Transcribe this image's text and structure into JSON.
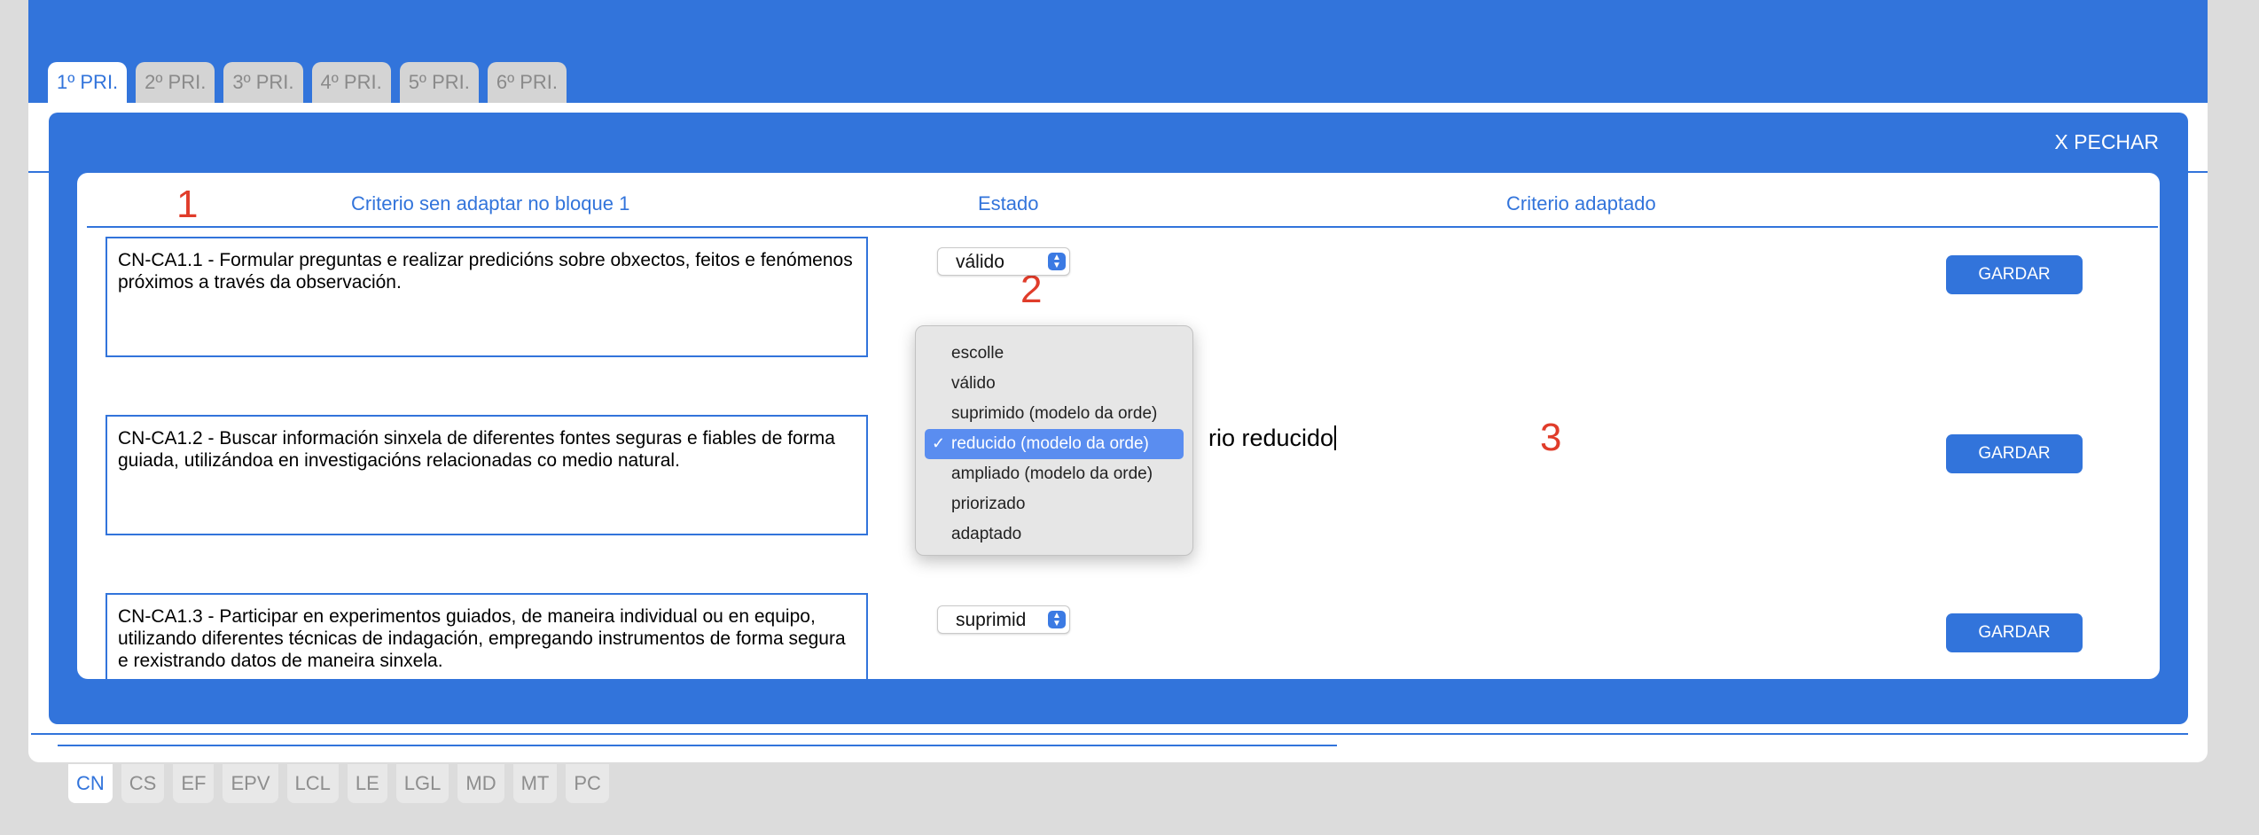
{
  "grade_tabs": [
    {
      "label": "1º PRI.",
      "active": true
    },
    {
      "label": "2º PRI.",
      "active": false
    },
    {
      "label": "3º PRI.",
      "active": false
    },
    {
      "label": "4º PRI.",
      "active": false
    },
    {
      "label": "5º PRI.",
      "active": false
    },
    {
      "label": "6º PRI.",
      "active": false
    }
  ],
  "modal": {
    "close_label": "X PECHAR",
    "headers": {
      "criterion": "Criterio sen adaptar no bloque 1",
      "status": "Estado",
      "adapted": "Criterio adaptado"
    },
    "rows": [
      {
        "criterion": "CN-CA1.1 - Formular preguntas e realizar predicións sobre obxectos, feitos e fenómenos próximos a través da observación.",
        "status": "válido",
        "save_label": "GARDAR"
      },
      {
        "criterion": "CN-CA1.2 - Buscar información sinxela de diferentes fontes seguras e fiables de forma guiada, utilizándoa en investigacións relacionadas co medio natural.",
        "status": "reducido (modelo da orde)",
        "adapted_text": "rio reducido",
        "save_label": "GARDAR"
      },
      {
        "criterion": "CN-CA1.3 - Participar en experimentos guiados, de maneira individual ou en equipo, utilizando diferentes técnicas de indagación, empregando instrumentos de forma segura e rexistrando datos de maneira sinxela.",
        "status": "suprimid",
        "save_label": "GARDAR"
      }
    ],
    "dropdown": {
      "options": [
        "escolle",
        "válido",
        "suprimido (modelo da orde)",
        "reducido (modelo da orde)",
        "ampliado (modelo da orde)",
        "priorizado",
        "adaptado"
      ],
      "selected_index": 3,
      "check_mark": "✓"
    },
    "annotations": [
      "1",
      "2",
      "3"
    ]
  },
  "subject_tabs": [
    {
      "label": "CN",
      "active": true
    },
    {
      "label": "CS",
      "active": false
    },
    {
      "label": "EF",
      "active": false
    },
    {
      "label": "EPV",
      "active": false
    },
    {
      "label": "LCL",
      "active": false
    },
    {
      "label": "LE",
      "active": false
    },
    {
      "label": "LGL",
      "active": false
    },
    {
      "label": "MD",
      "active": false
    },
    {
      "label": "MT",
      "active": false
    },
    {
      "label": "PC",
      "active": false
    }
  ],
  "colors": {
    "primary": "#3274db",
    "annotation": "#e03c2a",
    "dropdown_highlight": "#5a8df0",
    "background": "#dcdcdc"
  }
}
